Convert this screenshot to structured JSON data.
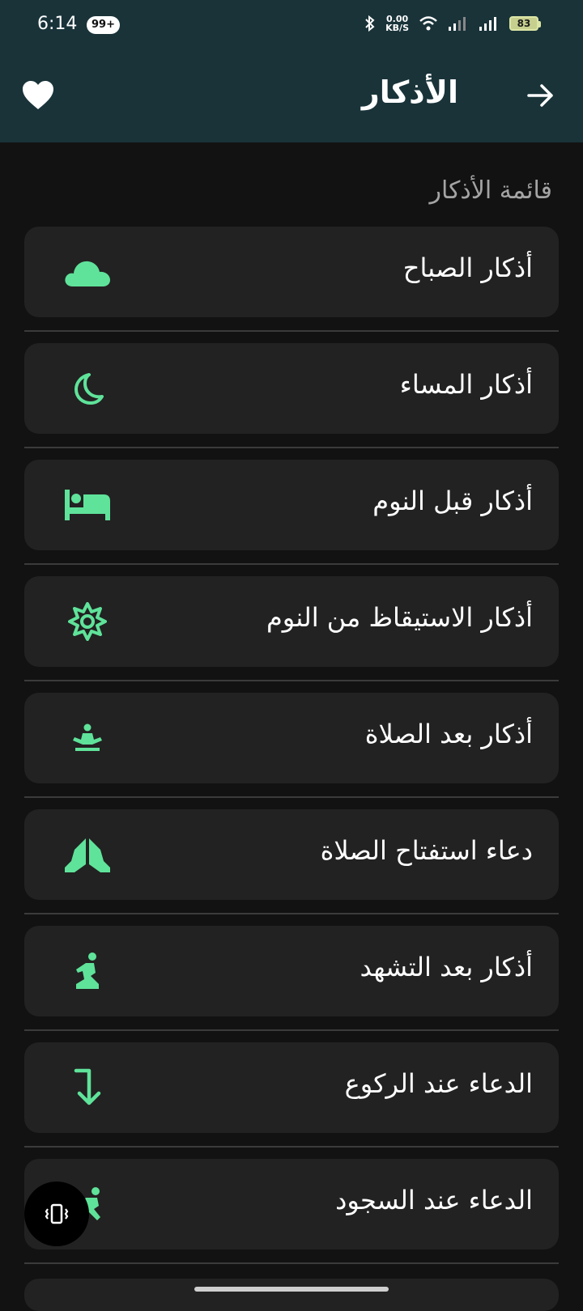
{
  "status": {
    "time": "6:14",
    "badge": "99+",
    "netspeed_value": "0.00",
    "netspeed_unit": "KB/S",
    "battery": "83"
  },
  "appbar": {
    "title": "الأذكار",
    "back_icon": "arrow-right-icon",
    "favorite_icon": "heart-icon"
  },
  "section_title": "قائمة الأذكار",
  "accent_color": "#5fe39a",
  "items": [
    {
      "label": "أذكار الصباح",
      "icon": "cloud-icon"
    },
    {
      "label": "أذكار المساء",
      "icon": "moon-icon"
    },
    {
      "label": "أذكار قبل النوم",
      "icon": "bed-icon"
    },
    {
      "label": "أذكار الاستيقاظ من النوم",
      "icon": "sun-icon"
    },
    {
      "label": "أذكار بعد الصلاة",
      "icon": "meditation-icon"
    },
    {
      "label": "دعاء استفتاح الصلاة",
      "icon": "praying-hands-icon"
    },
    {
      "label": "أذكار بعد التشهد",
      "icon": "kneeling-person-icon"
    },
    {
      "label": "الدعاء عند الركوع",
      "icon": "arrow-down-turn-icon"
    },
    {
      "label": "الدعاء عند السجود",
      "icon": "prostrating-person-icon"
    }
  ]
}
